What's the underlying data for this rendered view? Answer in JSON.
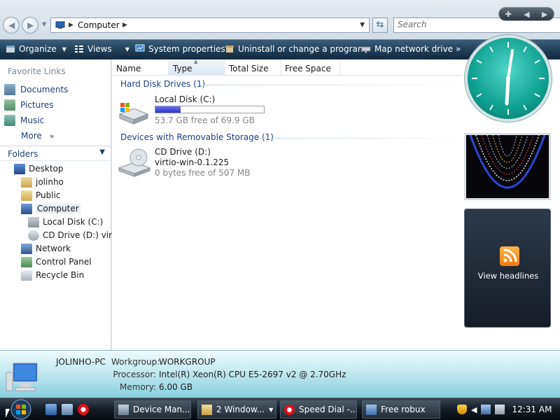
{
  "window": {
    "address": {
      "crumb": "Computer"
    },
    "search": {
      "placeholder": "Search"
    }
  },
  "toolbar": {
    "items": [
      {
        "label": "Organize",
        "icon": "organize-icon"
      },
      {
        "label": "Views",
        "icon": "views-icon"
      },
      {
        "label": "System properties",
        "icon": "system-properties-icon"
      },
      {
        "label": "Uninstall or change a program",
        "icon": "uninstall-icon"
      },
      {
        "label": "Map network drive",
        "icon": "map-drive-icon"
      }
    ],
    "overflow": "»"
  },
  "sidebar": {
    "favorites_title": "Favorite Links",
    "favorites": [
      {
        "label": "Documents",
        "icon": "documents-icon"
      },
      {
        "label": "Pictures",
        "icon": "pictures-icon"
      },
      {
        "label": "Music",
        "icon": "music-icon"
      }
    ],
    "more_label": "More",
    "more_arrow": "»",
    "folders_title": "Folders",
    "tree": [
      {
        "label": "Desktop",
        "icon": "desktop-icon"
      },
      {
        "label": "jolinho",
        "icon": "user-folder-icon"
      },
      {
        "label": "Public",
        "icon": "folder-icon"
      },
      {
        "label": "Computer",
        "icon": "computer-icon"
      },
      {
        "label": "Local Disk (C:)",
        "icon": "hard-disk-icon"
      },
      {
        "label": "CD Drive (D:) virtio",
        "icon": "cd-drive-icon"
      },
      {
        "label": "Network",
        "icon": "network-icon"
      },
      {
        "label": "Control Panel",
        "icon": "control-panel-icon"
      },
      {
        "label": "Recycle Bin",
        "icon": "recycle-bin-icon"
      }
    ]
  },
  "main": {
    "columns": [
      "Name",
      "Type",
      "Total Size",
      "Free Space"
    ],
    "groups": [
      {
        "title": "Hard Disk Drives (1)",
        "drive": {
          "name": "Local Disk (C:)",
          "free": "53.7 GB free of 69.9 GB",
          "used_fraction": 0.23
        }
      },
      {
        "title": "Devices with Removable Storage (1)",
        "drive": {
          "name": "CD Drive (D:)",
          "label": "virtio-win-0.1.225",
          "free": "0 bytes free of 507 MB"
        }
      }
    ]
  },
  "gadgets": {
    "feed_label": "View headlines"
  },
  "details": {
    "pc_name": "JOLINHO-PC",
    "workgroup_label": "Workgroup:",
    "workgroup": "WORKGROUP",
    "processor_label": "Processor:",
    "processor": "Intel(R) Xeon(R) CPU E5-2697 v2 @ 2.70GHz",
    "memory_label": "Memory:",
    "memory": "6.00 GB"
  },
  "taskbar": {
    "tasks": [
      {
        "label": "Device Man...",
        "icon": "device-manager-icon"
      },
      {
        "label": "2 Window...",
        "icon": "explorer-folder-icon"
      },
      {
        "label": "Speed Dial -...",
        "icon": "opera-icon"
      },
      {
        "label": "Free robux",
        "icon": "window-icon"
      }
    ],
    "clock": "12:31 AM"
  },
  "colors": {
    "toolbar": "#1f3d56",
    "link": "#1c3d78",
    "capacity_fill": "#2f33c9",
    "clock_face": "#0f9f8f",
    "rss": "#f17c0e"
  }
}
